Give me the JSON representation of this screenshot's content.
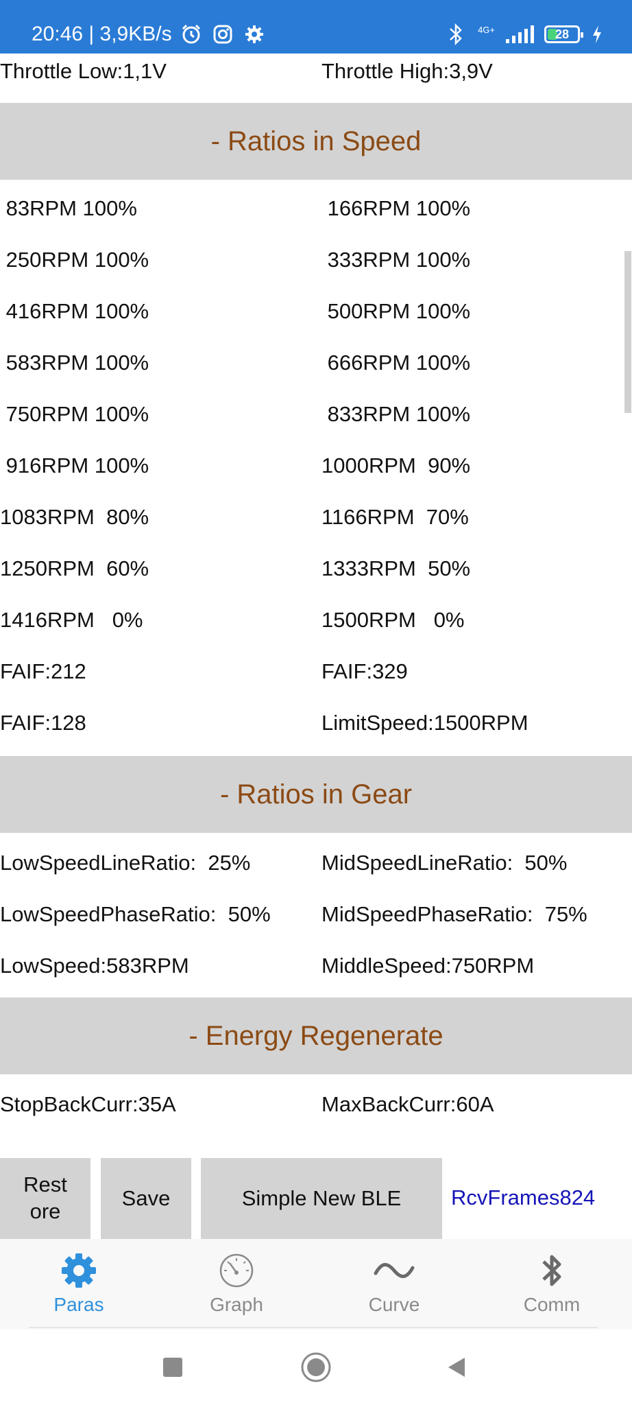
{
  "status_bar": {
    "time_speed": "20:46 | 3,9KB/s",
    "network": "4G+",
    "battery_level": "28",
    "icons": [
      "alarm-icon",
      "instagram-icon",
      "settings-icon",
      "bluetooth-icon",
      "signal-icon",
      "battery-icon",
      "charging-icon"
    ]
  },
  "throttle": {
    "low": "Throttle Low:1,1V",
    "high": "Throttle High:3,9V"
  },
  "sections": {
    "speed": "- Ratios in Speed",
    "gear": "- Ratios in Gear",
    "regen": "- Energy Regenerate"
  },
  "speed_rows": [
    [
      " 83RPM 100%",
      " 166RPM 100%"
    ],
    [
      " 250RPM 100%",
      " 333RPM 100%"
    ],
    [
      " 416RPM 100%",
      " 500RPM 100%"
    ],
    [
      " 583RPM 100%",
      " 666RPM 100%"
    ],
    [
      " 750RPM 100%",
      " 833RPM 100%"
    ],
    [
      " 916RPM 100%",
      "1000RPM  90%"
    ],
    [
      "1083RPM  80%",
      "1166RPM  70%"
    ],
    [
      "1250RPM  60%",
      "1333RPM  50%"
    ],
    [
      "1416RPM   0%",
      "1500RPM   0%"
    ]
  ],
  "faif_rows": [
    [
      "FAIF:212",
      "FAIF:329"
    ],
    [
      "FAIF:128",
      "LimitSpeed:1500RPM"
    ]
  ],
  "gear_rows": [
    [
      "LowSpeedLineRatio:  25%",
      "MidSpeedLineRatio:  50%"
    ],
    [
      "LowSpeedPhaseRatio:  50%",
      "MidSpeedPhaseRatio:  75%"
    ],
    [
      "LowSpeed:583RPM",
      "MiddleSpeed:750RPM"
    ]
  ],
  "regen_rows": [
    [
      "StopBackCurr:35A",
      "MaxBackCurr:60A"
    ]
  ],
  "buttons": {
    "restore_line1": "Rest",
    "restore_line2": "ore",
    "save": "Save",
    "ble": "Simple New BLE"
  },
  "rcv_frames": "RcvFrames824",
  "tabs": [
    {
      "label": "Paras",
      "icon": "gear-icon",
      "active": true
    },
    {
      "label": "Graph",
      "icon": "gauge-icon",
      "active": false
    },
    {
      "label": "Curve",
      "icon": "wave-icon",
      "active": false
    },
    {
      "label": "Comm",
      "icon": "bluetooth-icon",
      "active": false
    }
  ],
  "colors": {
    "status_bar": "#2a7bd6",
    "section_bg": "#d3d3d3",
    "section_text": "#8b4a14",
    "active_tab": "#2f90dc",
    "rcv_text": "#1515b8"
  }
}
